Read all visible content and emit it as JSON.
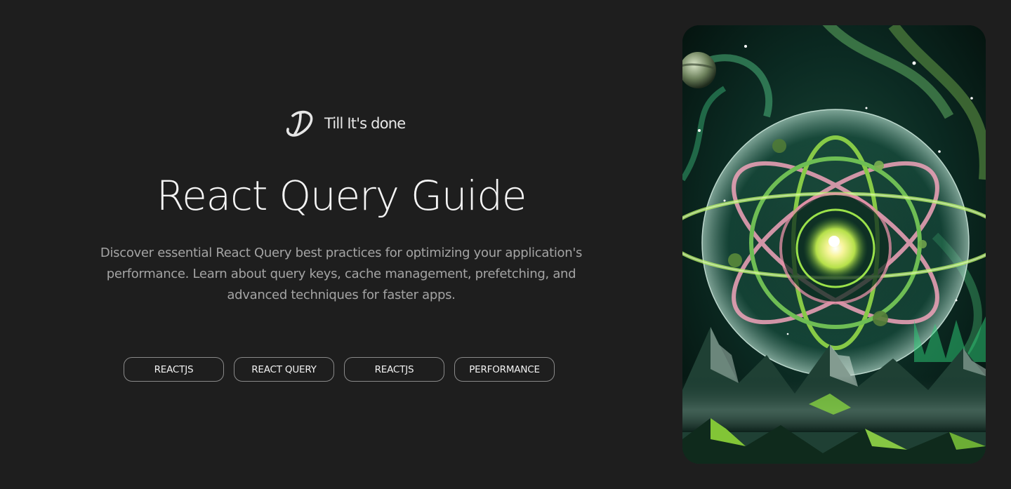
{
  "brand": {
    "name": "Till It's done",
    "logo_icon": "td-monogram-icon"
  },
  "hero": {
    "title": "React Query Guide",
    "description": "Discover essential React Query best practices for optimizing your application's performance. Learn about query keys, cache management, prefetching, and advanced techniques for faster apps."
  },
  "tags": [
    {
      "label": "REACTJS"
    },
    {
      "label": "REACT QUERY"
    },
    {
      "label": "REACTJS"
    },
    {
      "label": "PERFORMANCE"
    }
  ],
  "cover_image": {
    "icon": "cosmic-aurora-illustration"
  },
  "colors": {
    "background": "#1e1e1e",
    "title": "#f4f4f4",
    "description": "#a4a4a4",
    "tag_border": "#8a8a8a",
    "accent_green": "#9be24a",
    "accent_pink": "#f2a0b8"
  }
}
